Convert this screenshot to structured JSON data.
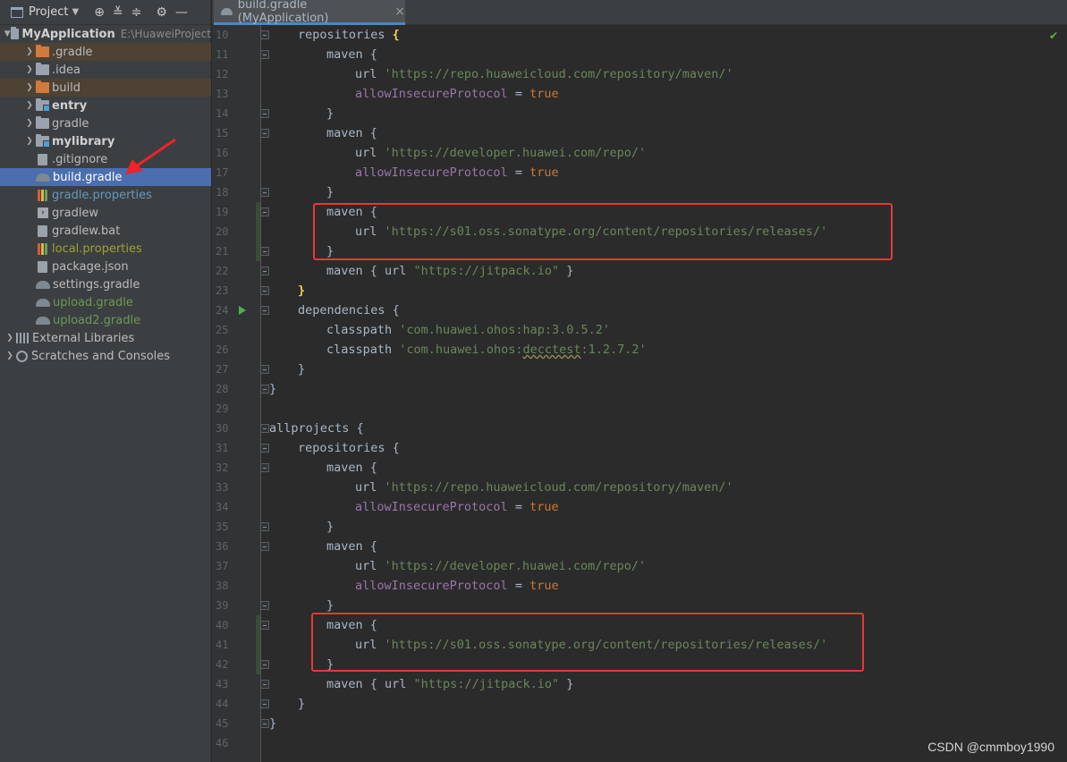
{
  "panel": {
    "title": "Project",
    "tree": [
      {
        "label": "MyApplication",
        "path": "E:\\HuaweiProject",
        "depth": 0,
        "expanded": true,
        "icon": "folder-icon",
        "style": "bold"
      },
      {
        "label": ".gradle",
        "depth": 1,
        "icon": "folder-icon",
        "style": "excluded"
      },
      {
        "label": ".idea",
        "depth": 1,
        "icon": "folder-icon",
        "style": ""
      },
      {
        "label": "build",
        "depth": 1,
        "icon": "folder-icon",
        "style": "excluded"
      },
      {
        "label": "entry",
        "depth": 1,
        "icon": "module-folder-icon",
        "style": "bold"
      },
      {
        "label": "gradle",
        "depth": 1,
        "icon": "folder-icon",
        "style": ""
      },
      {
        "label": "mylibrary",
        "depth": 1,
        "icon": "module-folder-icon",
        "style": "bold"
      },
      {
        "label": ".gitignore",
        "depth": 1,
        "icon": "file-icon",
        "style": ""
      },
      {
        "label": "build.gradle",
        "depth": 1,
        "icon": "gradle-icon",
        "style": "selected"
      },
      {
        "label": "gradle.properties",
        "depth": 1,
        "icon": "properties-icon",
        "style": "blue"
      },
      {
        "label": "gradlew",
        "depth": 1,
        "icon": "terminal-icon",
        "style": ""
      },
      {
        "label": "gradlew.bat",
        "depth": 1,
        "icon": "file-icon",
        "style": ""
      },
      {
        "label": "local.properties",
        "depth": 1,
        "icon": "properties-icon",
        "style": "olive"
      },
      {
        "label": "package.json",
        "depth": 1,
        "icon": "file-icon",
        "style": ""
      },
      {
        "label": "settings.gradle",
        "depth": 1,
        "icon": "gradle-icon",
        "style": ""
      },
      {
        "label": "upload.gradle",
        "depth": 1,
        "icon": "gradle-icon",
        "style": "green"
      },
      {
        "label": "upload2.gradle",
        "depth": 1,
        "icon": "gradle-icon",
        "style": "green"
      },
      {
        "label": "External Libraries",
        "depth": 0,
        "icon": "libraries-icon",
        "style": ""
      },
      {
        "label": "Scratches and Consoles",
        "depth": 0,
        "icon": "scratches-icon",
        "style": ""
      }
    ]
  },
  "tab": {
    "label": "build.gradle (MyApplication)",
    "close": "×"
  },
  "editor": {
    "lines": [
      {
        "n": 10,
        "indent": 1,
        "parts": [
          [
            "t",
            "repositories "
          ],
          [
            "hl",
            "{"
          ]
        ]
      },
      {
        "n": 11,
        "indent": 2,
        "parts": [
          [
            "t",
            "maven {"
          ]
        ]
      },
      {
        "n": 12,
        "indent": 3,
        "parts": [
          [
            "t",
            "url "
          ],
          [
            "s",
            "'https://repo.huaweicloud.com/repository/maven/'"
          ]
        ]
      },
      {
        "n": 13,
        "indent": 3,
        "parts": [
          [
            "p",
            "allowInsecureProtocol"
          ],
          [
            "t",
            " = "
          ],
          [
            "k",
            "true"
          ]
        ]
      },
      {
        "n": 14,
        "indent": 2,
        "parts": [
          [
            "t",
            "}"
          ]
        ]
      },
      {
        "n": 15,
        "indent": 2,
        "parts": [
          [
            "t",
            "maven {"
          ]
        ]
      },
      {
        "n": 16,
        "indent": 3,
        "parts": [
          [
            "t",
            "url "
          ],
          [
            "s",
            "'https://developer.huawei.com/repo/'"
          ]
        ]
      },
      {
        "n": 17,
        "indent": 3,
        "parts": [
          [
            "p",
            "allowInsecureProtocol"
          ],
          [
            "t",
            " = "
          ],
          [
            "k",
            "true"
          ]
        ]
      },
      {
        "n": 18,
        "indent": 2,
        "parts": [
          [
            "t",
            "}"
          ]
        ]
      },
      {
        "n": 19,
        "indent": 2,
        "parts": [
          [
            "t",
            "maven {"
          ]
        ]
      },
      {
        "n": 20,
        "indent": 3,
        "parts": [
          [
            "t",
            "url "
          ],
          [
            "s",
            "'https://s01.oss.sonatype.org/content/repositories/releases/'"
          ]
        ]
      },
      {
        "n": 21,
        "indent": 2,
        "parts": [
          [
            "t",
            "}"
          ]
        ]
      },
      {
        "n": 22,
        "indent": 2,
        "parts": [
          [
            "t",
            "maven { url "
          ],
          [
            "s",
            "\"https://jitpack.io\""
          ],
          [
            "t",
            " }"
          ]
        ]
      },
      {
        "n": 23,
        "indent": 1,
        "parts": [
          [
            "hl",
            "}"
          ]
        ]
      },
      {
        "n": 24,
        "indent": 1,
        "parts": [
          [
            "t",
            "dependencies {"
          ]
        ]
      },
      {
        "n": 25,
        "indent": 2,
        "parts": [
          [
            "t",
            "classpath "
          ],
          [
            "s",
            "'com.huawei.ohos:hap:3.0.5.2'"
          ]
        ]
      },
      {
        "n": 26,
        "indent": 2,
        "parts": [
          [
            "t",
            "classpath "
          ],
          [
            "s",
            "'com.huawei.ohos:"
          ],
          [
            "sq",
            "decctest"
          ],
          [
            "s",
            ":1.2.7.2'"
          ]
        ]
      },
      {
        "n": 27,
        "indent": 1,
        "parts": [
          [
            "t",
            "}"
          ]
        ]
      },
      {
        "n": 28,
        "indent": 0,
        "parts": [
          [
            "t",
            "}"
          ]
        ]
      },
      {
        "n": 29,
        "indent": 0,
        "parts": []
      },
      {
        "n": 30,
        "indent": 0,
        "parts": [
          [
            "t",
            "allprojects {"
          ]
        ]
      },
      {
        "n": 31,
        "indent": 1,
        "parts": [
          [
            "t",
            "repositories {"
          ]
        ]
      },
      {
        "n": 32,
        "indent": 2,
        "parts": [
          [
            "t",
            "maven {"
          ]
        ]
      },
      {
        "n": 33,
        "indent": 3,
        "parts": [
          [
            "t",
            "url "
          ],
          [
            "s",
            "'https://repo.huaweicloud.com/repository/maven/'"
          ]
        ]
      },
      {
        "n": 34,
        "indent": 3,
        "parts": [
          [
            "p",
            "allowInsecureProtocol"
          ],
          [
            "t",
            " = "
          ],
          [
            "k",
            "true"
          ]
        ]
      },
      {
        "n": 35,
        "indent": 2,
        "parts": [
          [
            "t",
            "}"
          ]
        ]
      },
      {
        "n": 36,
        "indent": 2,
        "parts": [
          [
            "t",
            "maven {"
          ]
        ]
      },
      {
        "n": 37,
        "indent": 3,
        "parts": [
          [
            "t",
            "url "
          ],
          [
            "s",
            "'https://developer.huawei.com/repo/'"
          ]
        ]
      },
      {
        "n": 38,
        "indent": 3,
        "parts": [
          [
            "p",
            "allowInsecureProtocol"
          ],
          [
            "t",
            " = "
          ],
          [
            "k",
            "true"
          ]
        ]
      },
      {
        "n": 39,
        "indent": 2,
        "parts": [
          [
            "t",
            "}"
          ]
        ]
      },
      {
        "n": 40,
        "indent": 2,
        "parts": [
          [
            "t",
            "maven {"
          ]
        ]
      },
      {
        "n": 41,
        "indent": 3,
        "parts": [
          [
            "t",
            "url "
          ],
          [
            "s",
            "'https://s01.oss.sonatype.org/content/repositories/releases/'"
          ]
        ]
      },
      {
        "n": 42,
        "indent": 2,
        "parts": [
          [
            "t",
            "}"
          ]
        ]
      },
      {
        "n": 43,
        "indent": 2,
        "parts": [
          [
            "t",
            "maven { url "
          ],
          [
            "s",
            "\"https://jitpack.io\""
          ],
          [
            "t",
            " }"
          ]
        ]
      },
      {
        "n": 44,
        "indent": 1,
        "parts": [
          [
            "t",
            "}"
          ]
        ]
      },
      {
        "n": 45,
        "indent": 0,
        "parts": [
          [
            "t",
            "}"
          ]
        ]
      },
      {
        "n": 46,
        "indent": 0,
        "parts": []
      }
    ]
  },
  "colors": {
    "accent": "#4b6eaf",
    "highlight_box": "#e53935",
    "string": "#6a8759",
    "keyword": "#cc7832",
    "property": "#9876aa"
  },
  "watermark": "CSDN @cmmboy1990"
}
